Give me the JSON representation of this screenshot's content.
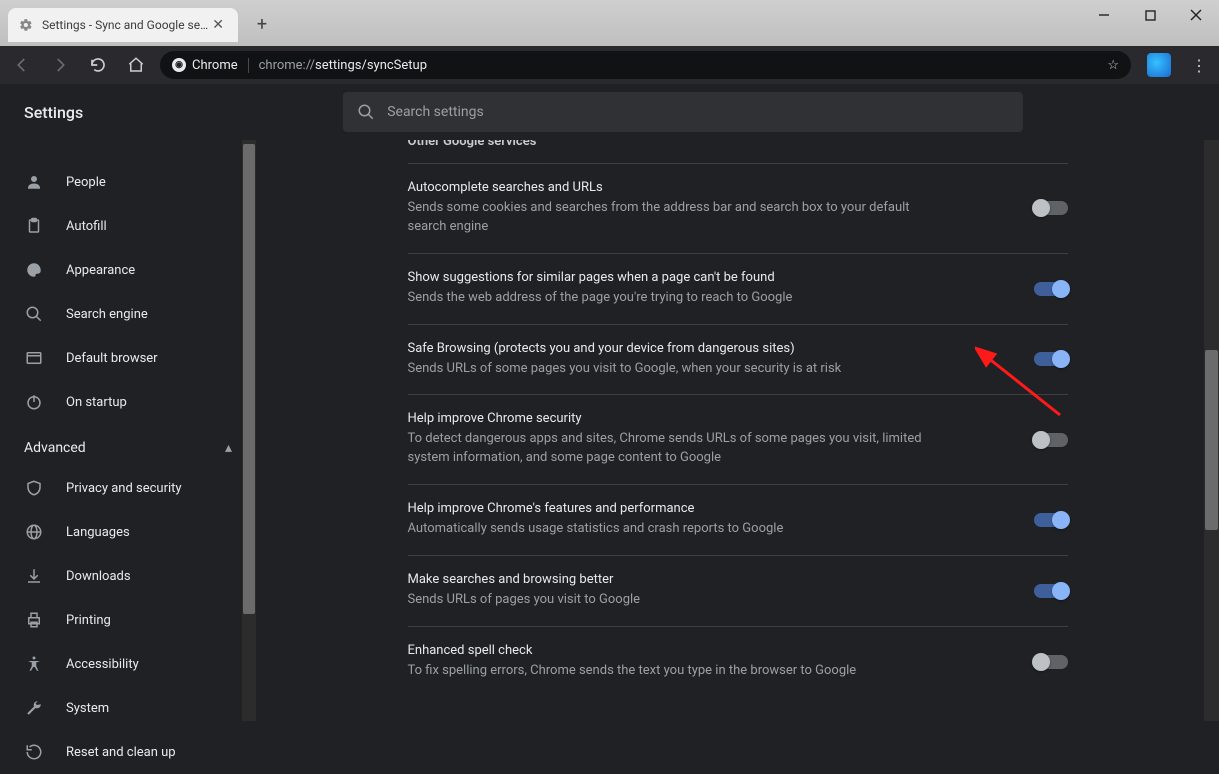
{
  "window": {
    "tab_title": "Settings - Sync and Google servic",
    "app_label": "Chrome",
    "url_prefix": "chrome://",
    "url_path": "settings/syncSetup"
  },
  "header": {
    "title": "Settings",
    "search_placeholder": "Search settings"
  },
  "sidebar": {
    "items": [
      {
        "label": "People"
      },
      {
        "label": "Autofill"
      },
      {
        "label": "Appearance"
      },
      {
        "label": "Search engine"
      },
      {
        "label": "Default browser"
      },
      {
        "label": "On startup"
      }
    ],
    "advanced_label": "Advanced",
    "adv_items": [
      {
        "label": "Privacy and security"
      },
      {
        "label": "Languages"
      },
      {
        "label": "Downloads"
      },
      {
        "label": "Printing"
      },
      {
        "label": "Accessibility"
      },
      {
        "label": "System"
      },
      {
        "label": "Reset and clean up"
      }
    ]
  },
  "main": {
    "section_title": "Other Google services",
    "rows": [
      {
        "title": "Autocomplete searches and URLs",
        "sub": "Sends some cookies and searches from the address bar and search box to your default search engine",
        "on": false
      },
      {
        "title": "Show suggestions for similar pages when a page can't be found",
        "sub": "Sends the web address of the page you're trying to reach to Google",
        "on": true
      },
      {
        "title": "Safe Browsing (protects you and your device from dangerous sites)",
        "sub": "Sends URLs of some pages you visit to Google, when your security is at risk",
        "on": true
      },
      {
        "title": "Help improve Chrome security",
        "sub": "To detect dangerous apps and sites, Chrome sends URLs of some pages you visit, limited system information, and some page content to Google",
        "on": false
      },
      {
        "title": "Help improve Chrome's features and performance",
        "sub": "Automatically sends usage statistics and crash reports to Google",
        "on": true
      },
      {
        "title": "Make searches and browsing better",
        "sub": "Sends URLs of pages you visit to Google",
        "on": true
      },
      {
        "title": "Enhanced spell check",
        "sub": "To fix spelling errors, Chrome sends the text you type in the browser to Google",
        "on": false
      }
    ]
  }
}
